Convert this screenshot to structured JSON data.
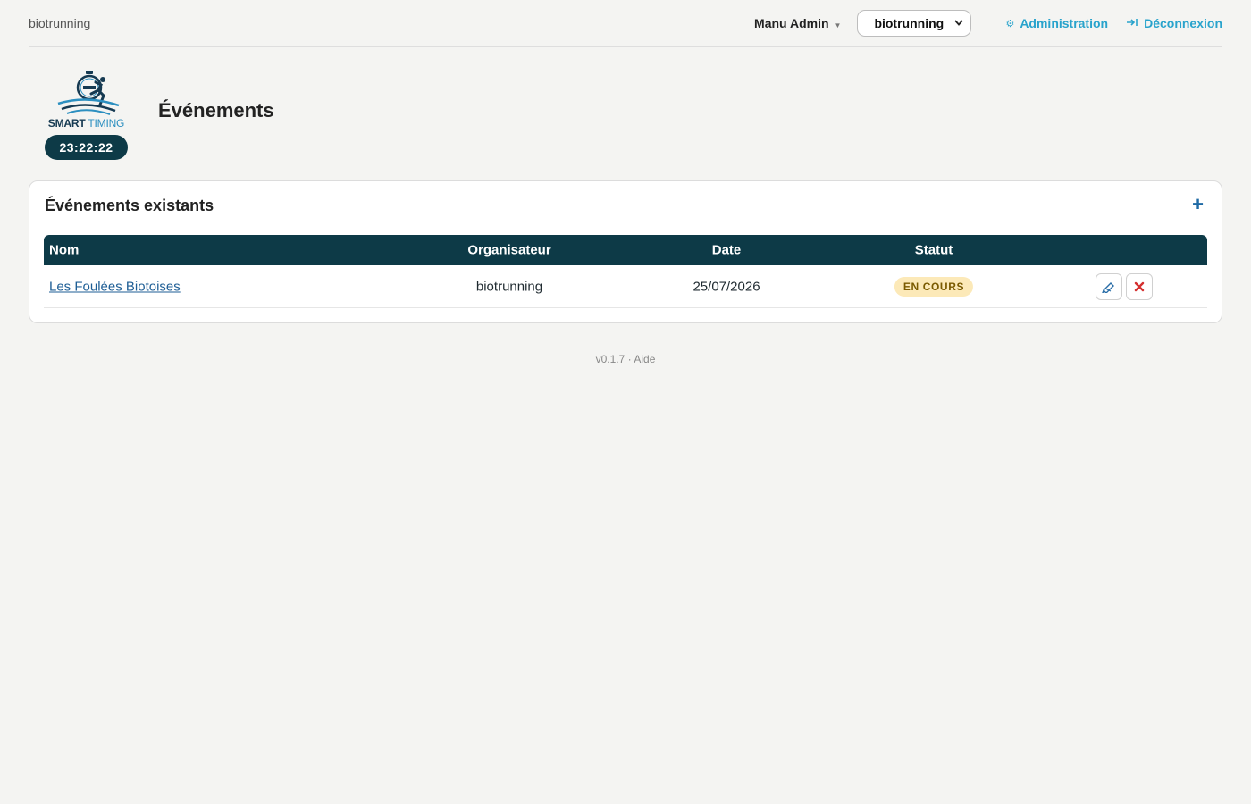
{
  "topbar": {
    "brand": "biotrunning",
    "user_name": "Manu Admin",
    "org_selected": "biotrunning",
    "admin_label": "Administration",
    "logout_label": "Déconnexion"
  },
  "header": {
    "logo_smart": "SMART",
    "logo_timing": "TIMING",
    "clock": "23:22:22",
    "title": "Événements"
  },
  "card": {
    "title": "Événements existants",
    "add_label": "+",
    "columns": {
      "name": "Nom",
      "organizer": "Organisateur",
      "date": "Date",
      "status": "Statut"
    },
    "rows": [
      {
        "name": "Les Foulées Biotoises",
        "organizer": "biotrunning",
        "date": "25/07/2026",
        "status": "EN COURS"
      }
    ]
  },
  "footer": {
    "version": "v0.1.7",
    "separator": "·",
    "help_label": "Aide"
  },
  "colors": {
    "accent": "#29a3cc",
    "table_header": "#0d3a47",
    "badge_bg": "#fce9b8",
    "delete": "#d42f2f"
  },
  "icons": {
    "user_caret": "caret-down-icon",
    "admin": "gear-icon",
    "logout": "logout-arrow-icon",
    "add": "plus-icon",
    "edit": "pencil-icon",
    "delete": "close-icon"
  }
}
